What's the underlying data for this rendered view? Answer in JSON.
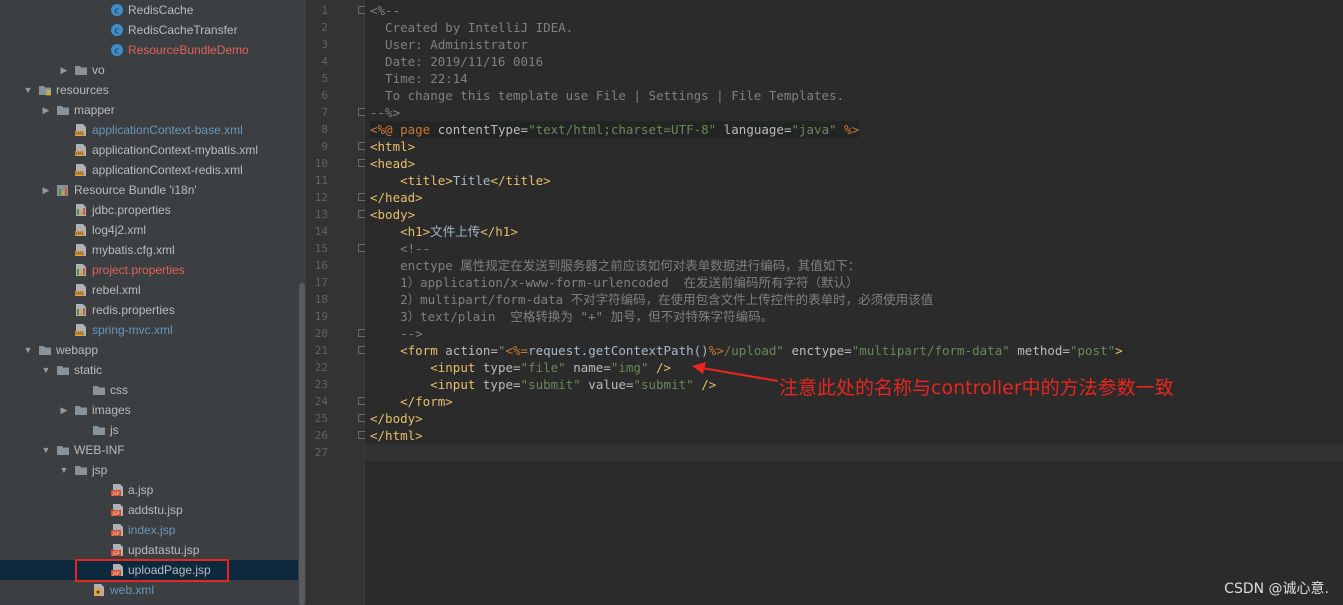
{
  "tree": {
    "items": [
      {
        "label": "RedisCache",
        "indent": 92,
        "expander": "none",
        "icon": "java-class-icon",
        "color": "norm"
      },
      {
        "label": "RedisCacheTransfer",
        "indent": 92,
        "expander": "none",
        "icon": "java-class-icon",
        "color": "norm"
      },
      {
        "label": "ResourceBundleDemo",
        "indent": 92,
        "expander": "none",
        "icon": "java-class-icon",
        "color": "red"
      },
      {
        "label": "vo",
        "indent": 56,
        "expander": "collapsed",
        "icon": "folder-icon",
        "color": "norm"
      },
      {
        "label": "resources",
        "indent": 20,
        "expander": "expanded",
        "icon": "resources-folder-icon",
        "color": "norm"
      },
      {
        "label": "mapper",
        "indent": 38,
        "expander": "collapsed",
        "icon": "folder-icon",
        "color": "norm"
      },
      {
        "label": "applicationContext-base.xml",
        "indent": 56,
        "expander": "none",
        "icon": "xml-file-icon",
        "color": "blue"
      },
      {
        "label": "applicationContext-mybatis.xml",
        "indent": 56,
        "expander": "none",
        "icon": "xml-file-icon",
        "color": "norm"
      },
      {
        "label": "applicationContext-redis.xml",
        "indent": 56,
        "expander": "none",
        "icon": "xml-file-icon",
        "color": "norm"
      },
      {
        "label": "Resource Bundle 'i18n'",
        "indent": 38,
        "expander": "collapsed",
        "icon": "resource-bundle-icon",
        "color": "norm"
      },
      {
        "label": "jdbc.properties",
        "indent": 56,
        "expander": "none",
        "icon": "properties-file-icon",
        "color": "norm"
      },
      {
        "label": "log4j2.xml",
        "indent": 56,
        "expander": "none",
        "icon": "xml-file-icon",
        "color": "norm"
      },
      {
        "label": "mybatis.cfg.xml",
        "indent": 56,
        "expander": "none",
        "icon": "xml-file-icon",
        "color": "norm"
      },
      {
        "label": "project.properties",
        "indent": 56,
        "expander": "none",
        "icon": "properties-file-icon",
        "color": "red"
      },
      {
        "label": "rebel.xml",
        "indent": 56,
        "expander": "none",
        "icon": "xml-file-icon",
        "color": "norm"
      },
      {
        "label": "redis.properties",
        "indent": 56,
        "expander": "none",
        "icon": "properties-file-icon",
        "color": "norm"
      },
      {
        "label": "spring-mvc.xml",
        "indent": 56,
        "expander": "none",
        "icon": "xml-file-icon",
        "color": "blue"
      },
      {
        "label": "webapp",
        "indent": 20,
        "expander": "expanded",
        "icon": "folder-icon",
        "color": "norm"
      },
      {
        "label": "static",
        "indent": 38,
        "expander": "expanded",
        "icon": "folder-icon",
        "color": "norm"
      },
      {
        "label": "css",
        "indent": 74,
        "expander": "none",
        "icon": "folder-icon",
        "color": "norm"
      },
      {
        "label": "images",
        "indent": 56,
        "expander": "collapsed",
        "icon": "folder-icon",
        "color": "norm"
      },
      {
        "label": "js",
        "indent": 74,
        "expander": "none",
        "icon": "folder-icon",
        "color": "norm"
      },
      {
        "label": "WEB-INF",
        "indent": 38,
        "expander": "expanded",
        "icon": "folder-icon",
        "color": "norm"
      },
      {
        "label": "jsp",
        "indent": 56,
        "expander": "expanded",
        "icon": "folder-icon",
        "color": "norm"
      },
      {
        "label": "a.jsp",
        "indent": 92,
        "expander": "none",
        "icon": "jsp-file-icon",
        "color": "norm"
      },
      {
        "label": "addstu.jsp",
        "indent": 92,
        "expander": "none",
        "icon": "jsp-file-icon",
        "color": "norm"
      },
      {
        "label": "index.jsp",
        "indent": 92,
        "expander": "none",
        "icon": "jsp-file-icon",
        "color": "blue"
      },
      {
        "label": "updatastu.jsp",
        "indent": 92,
        "expander": "none",
        "icon": "jsp-file-icon",
        "color": "norm"
      },
      {
        "label": "uploadPage.jsp",
        "indent": 92,
        "expander": "none",
        "icon": "jsp-file-icon",
        "color": "norm",
        "selected": true
      },
      {
        "label": "web.xml",
        "indent": 74,
        "expander": "none",
        "icon": "web-xml-icon",
        "color": "blue"
      }
    ]
  },
  "editor": {
    "line_numbers": [
      "1",
      "2",
      "3",
      "4",
      "5",
      "6",
      "7",
      "8",
      "9",
      "10",
      "11",
      "12",
      "13",
      "14",
      "15",
      "16",
      "17",
      "18",
      "19",
      "20",
      "21",
      "22",
      "23",
      "24",
      "25",
      "26",
      "27"
    ],
    "current_line": 27,
    "lines": [
      [
        {
          "t": "<%--",
          "c": "comment"
        }
      ],
      [
        {
          "t": "  Created by IntelliJ IDEA.",
          "c": "comment"
        }
      ],
      [
        {
          "t": "  User: Administrator",
          "c": "comment"
        }
      ],
      [
        {
          "t": "  Date: 2019/11/16 0016",
          "c": "comment"
        }
      ],
      [
        {
          "t": "  Time: 22:14",
          "c": "comment"
        }
      ],
      [
        {
          "t": "  To change this template use File | Settings | File Templates.",
          "c": "comment"
        }
      ],
      [
        {
          "t": "--%>",
          "c": "comment"
        }
      ],
      [
        {
          "t": "<%@ ",
          "c": "dir"
        },
        {
          "t": "page ",
          "c": "kw"
        },
        {
          "t": "contentType=",
          "c": "attr"
        },
        {
          "t": "\"text/html;charset=UTF-8\"",
          "c": "str"
        },
        {
          "t": " language=",
          "c": "attr"
        },
        {
          "t": "\"java\"",
          "c": "str"
        },
        {
          "t": " %>",
          "c": "dir"
        }
      ],
      [
        {
          "t": "<html>",
          "c": "tag"
        }
      ],
      [
        {
          "t": "<head>",
          "c": "tag"
        }
      ],
      [
        {
          "t": "    ",
          "c": "text"
        },
        {
          "t": "<title>",
          "c": "tag"
        },
        {
          "t": "Title",
          "c": "text"
        },
        {
          "t": "</title>",
          "c": "tag"
        }
      ],
      [
        {
          "t": "</head>",
          "c": "tag"
        }
      ],
      [
        {
          "t": "<body>",
          "c": "tag"
        }
      ],
      [
        {
          "t": "    ",
          "c": "text"
        },
        {
          "t": "<h1>",
          "c": "tag"
        },
        {
          "t": "文件上传",
          "c": "text"
        },
        {
          "t": "</h1>",
          "c": "tag"
        }
      ],
      [
        {
          "t": "    <!--",
          "c": "comment"
        }
      ],
      [
        {
          "t": "    enctype 属性规定在发送到服务器之前应该如何对表单数据进行编码，其值如下：",
          "c": "comment"
        }
      ],
      [
        {
          "t": "    1）application/x-www-form-urlencoded  在发送前编码所有字符（默认）",
          "c": "comment"
        }
      ],
      [
        {
          "t": "    2）multipart/form-data 不对字符编码，在使用包含文件上传控件的表单时，必须使用该值",
          "c": "comment"
        }
      ],
      [
        {
          "t": "    3）text/plain  空格转换为 \"+\" 加号，但不对特殊字符编码。",
          "c": "comment"
        }
      ],
      [
        {
          "t": "    -->",
          "c": "comment"
        }
      ],
      [
        {
          "t": "    ",
          "c": "text"
        },
        {
          "t": "<form ",
          "c": "tag"
        },
        {
          "t": "action=",
          "c": "attr"
        },
        {
          "t": "\"",
          "c": "str"
        },
        {
          "t": "<%=",
          "c": "dir"
        },
        {
          "t": "request.getContextPath()",
          "c": "expr"
        },
        {
          "t": "%>",
          "c": "dir"
        },
        {
          "t": "/upload\"",
          "c": "str"
        },
        {
          "t": " enctype=",
          "c": "attr"
        },
        {
          "t": "\"multipart/form-data\"",
          "c": "str"
        },
        {
          "t": " method=",
          "c": "attr"
        },
        {
          "t": "\"post\"",
          "c": "str"
        },
        {
          "t": ">",
          "c": "tag"
        }
      ],
      [
        {
          "t": "        ",
          "c": "text"
        },
        {
          "t": "<input ",
          "c": "tag"
        },
        {
          "t": "type=",
          "c": "attr"
        },
        {
          "t": "\"file\"",
          "c": "str"
        },
        {
          "t": " name=",
          "c": "attr"
        },
        {
          "t": "\"img\"",
          "c": "str"
        },
        {
          "t": " />",
          "c": "tag"
        }
      ],
      [
        {
          "t": "        ",
          "c": "text"
        },
        {
          "t": "<input ",
          "c": "tag"
        },
        {
          "t": "type=",
          "c": "attr"
        },
        {
          "t": "\"submit\"",
          "c": "str"
        },
        {
          "t": " value=",
          "c": "attr"
        },
        {
          "t": "\"submit\"",
          "c": "str"
        },
        {
          "t": " />",
          "c": "tag"
        }
      ],
      [
        {
          "t": "    ",
          "c": "text"
        },
        {
          "t": "</form>",
          "c": "tag"
        }
      ],
      [
        {
          "t": "</body>",
          "c": "tag"
        }
      ],
      [
        {
          "t": "</html>",
          "c": "tag"
        }
      ],
      [
        {
          "t": "",
          "c": "text"
        }
      ]
    ]
  },
  "annotation": {
    "text": "注意此处的名称与controller中的方法参数一致",
    "color": "#e8261f"
  },
  "watermark": "CSDN @诚心意."
}
